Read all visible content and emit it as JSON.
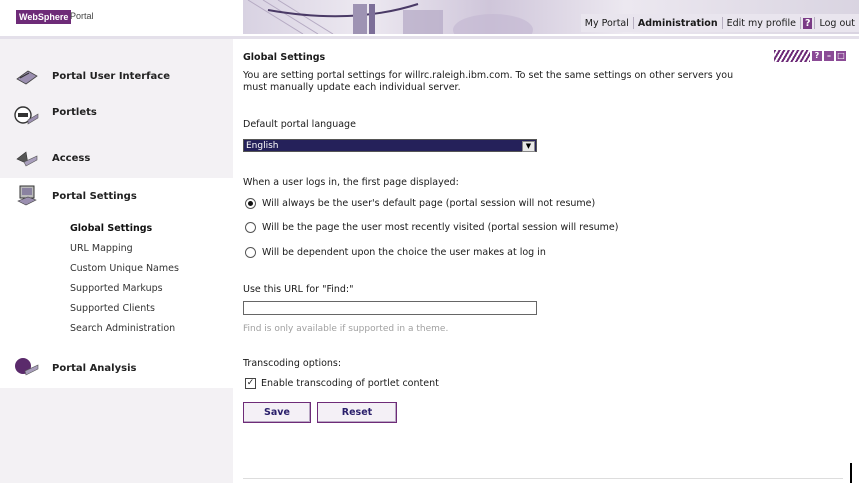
{
  "header": {
    "logo_brand": "WebSphere",
    "logo_product": "Portal",
    "nav": [
      "My Portal",
      "Administration",
      "Edit my profile"
    ],
    "help_icon_label": "?",
    "logout": "Log out"
  },
  "sidebar": {
    "sections": [
      {
        "label": "Portal User Interface",
        "icon": "palette-icon"
      },
      {
        "label": "Portlets",
        "icon": "portlet-icon"
      },
      {
        "label": "Access",
        "icon": "key-icon"
      },
      {
        "label": "Portal Settings",
        "icon": "settings-icon"
      },
      {
        "label": "Portal Analysis",
        "icon": "analysis-icon"
      }
    ],
    "subitems": [
      "Global Settings",
      "URL Mapping",
      "Custom Unique Names",
      "Supported Markups",
      "Supported Clients",
      "Search Administration"
    ]
  },
  "main": {
    "title": "Global Settings",
    "window_controls": [
      "?",
      "–",
      "□"
    ],
    "intro_line1": "You are setting portal settings for willrc.raleigh.ibm.com. To set the same settings on other servers you",
    "intro_line2": "must manually update each individual server.",
    "language_label": "Default portal language",
    "language_value": "English",
    "login_label": "When a user logs in, the first page displayed:",
    "radio_options": [
      {
        "label": "Will always be the user's default page (portal session will not resume)",
        "checked": true
      },
      {
        "label": "Will be the page the user most recently visited (portal session will resume)",
        "checked": false
      },
      {
        "label": "Will be dependent upon the choice the user makes at log in",
        "checked": false
      }
    ],
    "find_label": "Use this URL for \"Find:\"",
    "find_value": "",
    "find_hint": "Find is only available if supported in a theme.",
    "transcoding_label": "Transcoding options:",
    "transcoding_checkbox": "Enable transcoding of portlet content",
    "transcoding_checked": true,
    "save_label": "Save",
    "reset_label": "Reset"
  },
  "colors": {
    "accent": "#6e2b78",
    "selection": "#25215a"
  }
}
